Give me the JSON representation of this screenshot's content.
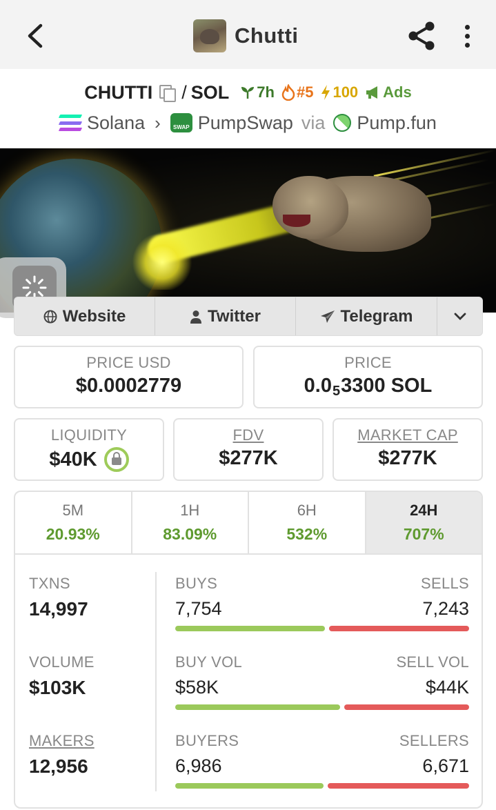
{
  "app_bar": {
    "title": "Chutti"
  },
  "pair": {
    "base": "CHUTTI",
    "separator": "/",
    "quote": "SOL",
    "age": "7h",
    "rank": "#5",
    "boosts": "100",
    "ads": "Ads"
  },
  "chain": {
    "network": "Solana",
    "dex": "PumpSwap",
    "swap_logo_text": "SWAP",
    "via": "via",
    "launchpad": "Pump.fun"
  },
  "links": {
    "website": "Website",
    "twitter": "Twitter",
    "telegram": "Telegram"
  },
  "price": {
    "usd_label": "PRICE USD",
    "usd_value": "$0.0002779",
    "native_label": "PRICE",
    "native_prefix": "0.0",
    "native_zeros": "5",
    "native_suffix": "3300 SOL"
  },
  "market": {
    "liquidity_label": "LIQUIDITY",
    "liquidity_value": "$40K",
    "fdv_label": "FDV",
    "fdv_value": "$277K",
    "mcap_label": "MARKET CAP",
    "mcap_value": "$277K"
  },
  "timeframes": [
    {
      "label": "5M",
      "change": "20.93%",
      "change_pct": 20.93
    },
    {
      "label": "1H",
      "change": "83.09%",
      "change_pct": 83.09
    },
    {
      "label": "6H",
      "change": "532%",
      "change_pct": 532
    },
    {
      "label": "24H",
      "change": "707%",
      "change_pct": 707,
      "active": true
    }
  ],
  "stats": {
    "txns_label": "TXNS",
    "txns_value": "14,997",
    "volume_label": "VOLUME",
    "volume_value": "$103K",
    "makers_label": "MAKERS",
    "makers_value": "12,956",
    "buys_label": "BUYS",
    "buys_value": "7,754",
    "buys": 7754,
    "sells_label": "SELLS",
    "sells_value": "7,243",
    "sells": 7243,
    "buy_vol_label": "BUY VOL",
    "buy_vol_value": "$58K",
    "buy_vol": 58,
    "sell_vol_label": "SELL VOL",
    "sell_vol_value": "$44K",
    "sell_vol": 44,
    "buyers_label": "BUYERS",
    "buyers_value": "6,986",
    "buyers": 6986,
    "sellers_label": "SELLERS",
    "sellers_value": "6,671",
    "sellers": 6671
  },
  "colors": {
    "positive": "#5e9a2f",
    "buy_bar": "#9bc95b",
    "sell_bar": "#e45a5a"
  }
}
